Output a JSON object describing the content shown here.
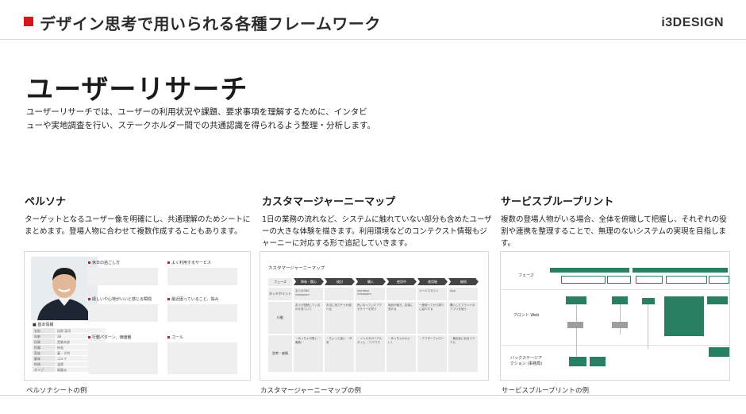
{
  "header": {
    "title": "デザイン思考で用いられる各種フレームワーク",
    "logo": "i3DESIGN"
  },
  "main": {
    "title": "ユーザーリサーチ",
    "lead": "ユーザーリサーチでは、ユーザーの利用状況や課題、要求事項を理解するために、インタビューや実地調査を行い、ステークホルダー間での共通認識を得られるよう整理・分析します。"
  },
  "columns": [
    {
      "title": "ペルソナ",
      "description": "ターゲットとなるユーザー像を明確にし、共通理解のためシートにまとめます。登場人物に合わせて複数作成することもあります。",
      "caption": "ペルソナシートの例"
    },
    {
      "title": "カスタマージャーニーマップ",
      "description": "1日の業務の流れなど、システムに触れていない部分も含めたユーザーの大きな体験を描きます。利用環境などのコンテクスト情報もジャーニーに対応する形で追記していきます。",
      "caption": "カスタマージャーニーマップの例"
    },
    {
      "title": "サービスブループリント",
      "description": "複数の登場人物がいる場合、全体を俯瞰して把握し、それぞれの役割や連携を整理することで、無理のないシステムの実現を目指します。",
      "caption": "サービスブループリントの例"
    }
  ],
  "persona_sheet": {
    "info_heading": "■ 基本情報",
    "info_rows": [
      {
        "k": "名前",
        "v": "田原 英司"
      },
      {
        "k": "年齢",
        "v": "38"
      },
      {
        "k": "所属",
        "v": "営業本部"
      },
      {
        "k": "役職",
        "v": "係長"
      },
      {
        "k": "家族",
        "v": "妻・子供"
      },
      {
        "k": "趣味",
        "v": "ゴルフ"
      },
      {
        "k": "性格",
        "v": "温厚"
      },
      {
        "k": "タイプ",
        "v": "慎重派"
      }
    ],
    "blocks": [
      "休日の過ごし方",
      "よく利用するサービス",
      "嬉しいや心地がいいと感じる瞬間",
      "最近困っていること、悩み",
      "行動パターン、価値観",
      "ゴール"
    ]
  },
  "journey_map": {
    "title": "カスタマージャーニーマップ",
    "phase_label": "フェーズ",
    "phases": [
      "興味・関心",
      "検討",
      "購入",
      "使用中",
      "使用後",
      "継続"
    ],
    "rows": [
      {
        "label": "タッチポイント",
        "cells": [
          "友人のSNS instagram",
          "",
          "storebox instagram",
          "",
          "メールマガジン",
          "App"
        ]
      },
      {
        "label": "行動",
        "cells": [
          "友人が投稿しているのを見ていて",
          "本当に良さそうか調べる",
          "良いなっていたアクセサリーを買う",
          "商品が届き、友達に見せる",
          "一度使ってから周りに紹介する",
          "購入したブランドのアプリを使う"
        ]
      },
      {
        "label": "思考・感情",
        "cells": [
          "・めっちゃ可愛い ・素敵！",
          "・ちょっと高い ・不安",
          "・インスタのリアルタイム ・ワクワク",
          "・めっちゃかわいい！",
          "・アフターフォロー",
          "・最近私に似合うアクセ"
        ]
      }
    ]
  },
  "blueprint": {
    "lanes": [
      "フェーズ",
      "フロント Web",
      "バックステージアクション (事務局)"
    ]
  }
}
